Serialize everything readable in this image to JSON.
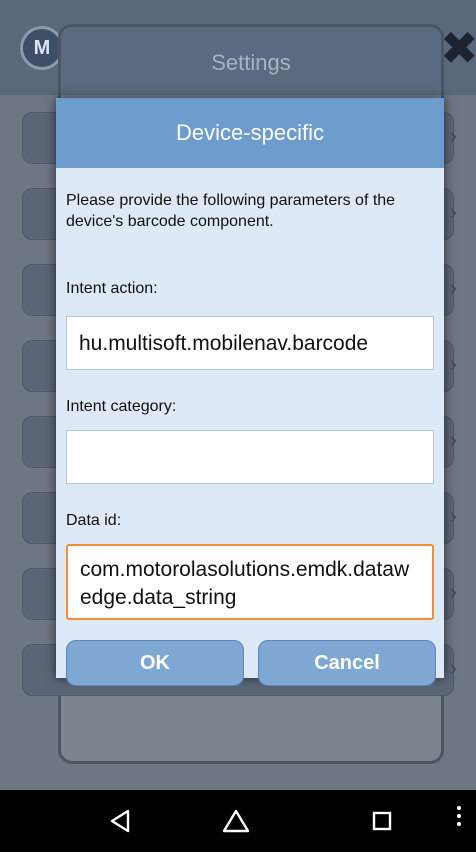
{
  "background_app": {
    "logo_text": "M",
    "settings_title": "Settings",
    "close_glyph": "✖"
  },
  "dialog": {
    "title": "Device-specific",
    "description": "Please provide the following parameters of the device's barcode component.",
    "fields": [
      {
        "label": "Intent action:",
        "value": "hu.multisoft.mobilenav.barcode",
        "placeholder": ""
      },
      {
        "label": "Intent category:",
        "value": "",
        "placeholder": ""
      },
      {
        "label": "Data id:",
        "value": "com.motorolasolutions.emdk.datawedge.data_string",
        "placeholder": ""
      }
    ],
    "buttons": {
      "ok_label": "OK",
      "cancel_label": "Cancel"
    }
  },
  "navbar": {
    "icons": [
      "back-icon",
      "home-icon",
      "recents-icon",
      "overflow-menu-icon"
    ]
  },
  "colors": {
    "dialog_header": "#6e9ccd",
    "dialog_body": "#dde9f6",
    "button": "#7ea7d4",
    "focus_border": "#f0902e"
  }
}
